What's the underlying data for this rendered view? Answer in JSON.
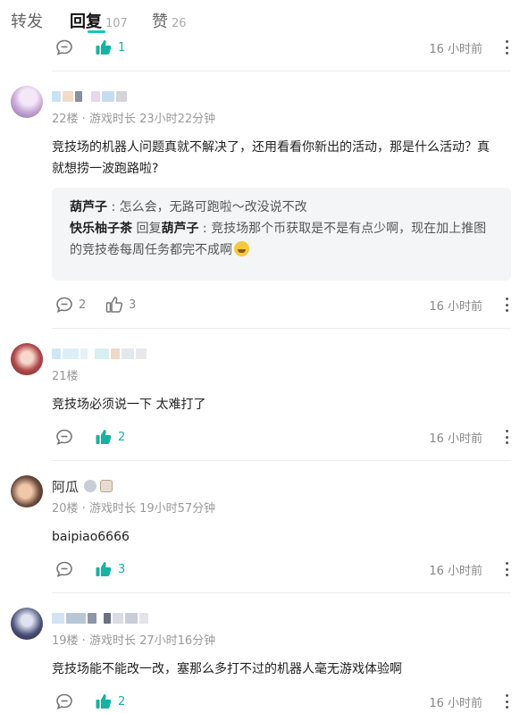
{
  "tabs": [
    {
      "label": "转发",
      "count": ""
    },
    {
      "label": "回复",
      "count": "107"
    },
    {
      "label": "赞",
      "count": "26"
    }
  ],
  "top_item": {
    "comment_count": "",
    "like_count": "1",
    "time": "16 小时前"
  },
  "comments": [
    {
      "username": "",
      "meta": "22楼 · 游戏时长 23小时22分钟",
      "content": "竞技场的机器人问题真就不解决了，还用看看你新出的活动，那是什么活动？真就想捞一波跑路啦?",
      "replies": [
        {
          "name": "葫芦子",
          "sep": " : ",
          "text": "怎么会，无路可跑啦～改没说不改"
        },
        {
          "name": "快乐柚子茶",
          "reply_word": " 回复",
          "reply_to": "葫芦子",
          "sep": " : ",
          "text": "竞技场那个币获取是不是有点少啊，现在加上推图的竞技卷每周任务都完不成啊"
        }
      ],
      "comment_count": "2",
      "like_count": "3",
      "time": "16 小时前"
    },
    {
      "username": "",
      "meta": "21楼",
      "content": "竞技场必须说一下 太难打了",
      "comment_count": "",
      "like_count": "2",
      "time": "16 小时前"
    },
    {
      "username": "阿瓜",
      "meta": "20楼 · 游戏时长 19小时57分钟",
      "content": "baipiao6666",
      "comment_count": "",
      "like_count": "3",
      "time": "16 小时前"
    },
    {
      "username": "",
      "meta": "19楼 · 游戏时长 27小时16分钟",
      "content": "竞技场能不能改一改，塞那么多打不过的机器人毫无游戏体验啊",
      "comment_count": "",
      "like_count": "2",
      "time": "16 小时前"
    }
  ],
  "colors": {
    "accent": "#14c8b4",
    "liked": "#14b4a0",
    "reply_bg": "#f4f5f6",
    "muted": "#999999"
  },
  "icons": {
    "comment": "comment-bubble-icon",
    "like": "thumbs-up-icon",
    "more": "more-vertical-icon"
  }
}
